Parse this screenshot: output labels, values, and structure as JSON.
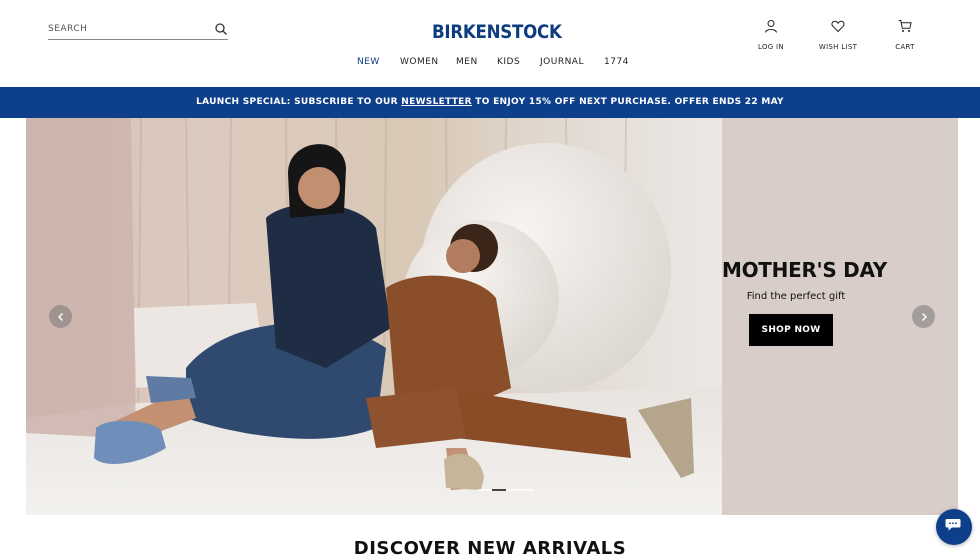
{
  "search": {
    "placeholder": "SEARCH",
    "icon": "search-icon"
  },
  "brand": {
    "logo_text": "BIRKENSTOCK",
    "color": "#0e3c80"
  },
  "utility": {
    "login": {
      "label": "LOG IN",
      "icon": "user-icon"
    },
    "wishlist": {
      "label": "WISH LIST",
      "icon": "heart-icon"
    },
    "cart": {
      "label": "CART",
      "icon": "cart-icon"
    }
  },
  "nav": {
    "items": [
      {
        "label": "NEW",
        "active": true
      },
      {
        "label": "WOMEN",
        "active": false
      },
      {
        "label": "MEN",
        "active": false
      },
      {
        "label": "KIDS",
        "active": false
      },
      {
        "label": "JOURNAL",
        "active": false
      },
      {
        "label": "1774",
        "active": false
      }
    ]
  },
  "promo": {
    "prefix": "LAUNCH SPECIAL: SUBSCRIBE TO OUR ",
    "link": "NEWSLETTER",
    "suffix": " TO ENJOY 15% OFF NEXT PURCHASE. OFFER ENDS 22 MAY",
    "background": "#0e3f8a"
  },
  "hero": {
    "title": "MOTHER'S DAY",
    "subtitle": "Find the perfect gift",
    "cta": "SHOP NOW",
    "slides": 3,
    "active_slide": 2,
    "prev_icon": "chevron-left-icon",
    "next_icon": "chevron-right-icon"
  },
  "section": {
    "title": "DISCOVER NEW ARRIVALS"
  },
  "chat": {
    "icon": "chat-bubble-icon"
  }
}
